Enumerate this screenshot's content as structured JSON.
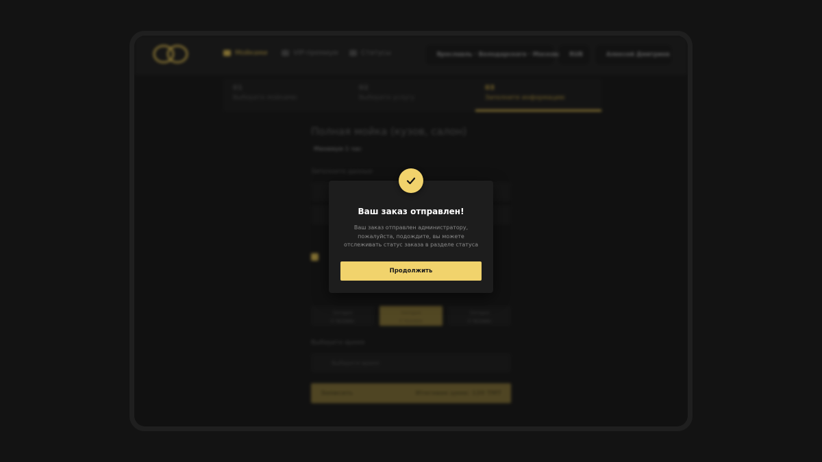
{
  "header": {
    "nav": [
      {
        "label": "Мойками",
        "icon": "wash-icon",
        "active": true
      },
      {
        "label": "VIP-премиум",
        "icon": "crown-icon",
        "active": false
      },
      {
        "label": "Статусы",
        "icon": "status-icon",
        "active": false
      }
    ],
    "location": "Ярославль · Володарского · Москова",
    "balance": "RUB",
    "user": "Алексей Дмитриев"
  },
  "steps": [
    {
      "num": "01",
      "label": "Выберите мойкамю"
    },
    {
      "num": "02",
      "label": "Выберите услугу"
    },
    {
      "num": "03",
      "label": "Заполните информацию"
    }
  ],
  "form": {
    "title": "Полная мойка (кузов, салон)",
    "duration": "Минимум 1 час",
    "fill_label": "Заполните данные",
    "select_time_label": "Выберите время",
    "time_placeholder": "Выберите время",
    "slots": [
      {
        "line1": "Сегодня",
        "line2": "0 Человек"
      },
      {
        "line1": "Сегодня",
        "line2": "0 Человек"
      },
      {
        "line1": "Сегодня",
        "line2": "0 Человек"
      }
    ],
    "submit_label": "Записать",
    "total_label": "Итоговая цена: 120 TMT"
  },
  "modal": {
    "icon": "check-icon",
    "title": "Ваш заказ отправлен!",
    "message_lines": [
      "Ваш заказ отправлен администратору,",
      "пожалуйста, подождите, вы можете",
      "отслеживать статус заказа в разделе статуса"
    ],
    "button_label": "Продолжить"
  },
  "colors": {
    "accent": "#f1d36c",
    "background": "#131313",
    "modal_bg": "#1d1d1d"
  }
}
